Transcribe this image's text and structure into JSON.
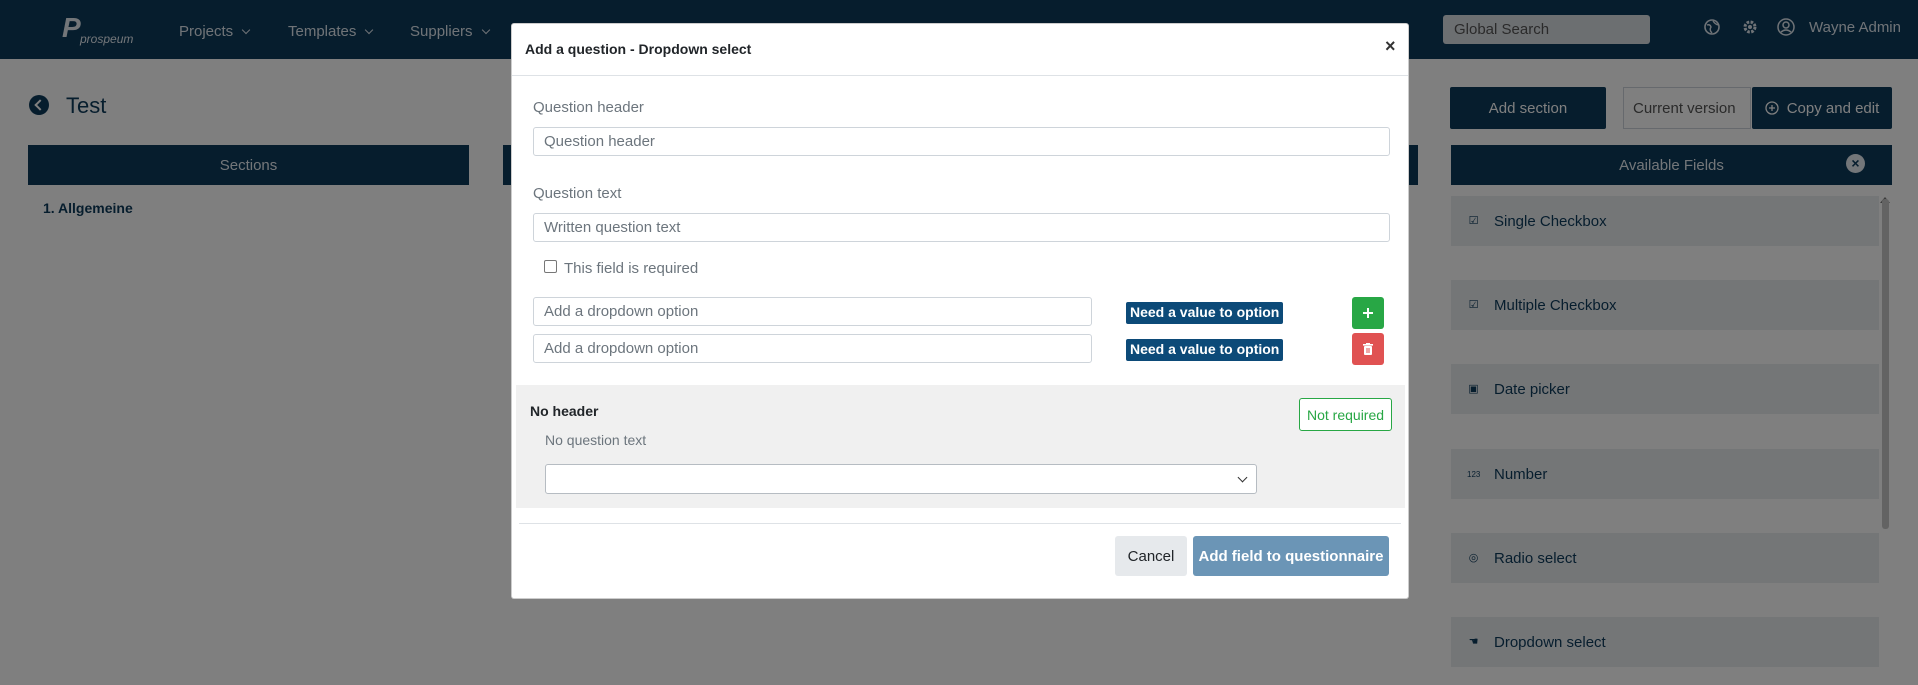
{
  "app": {
    "logo_mark": "P",
    "logo_word": "prospeum"
  },
  "nav": {
    "items": [
      {
        "label": "Projects"
      },
      {
        "label": "Templates"
      },
      {
        "label": "Suppliers"
      }
    ],
    "search_placeholder": "Global Search",
    "user_name": "Wayne Admin",
    "icons": [
      "globe-icon",
      "gear-icon",
      "user-circle-icon"
    ]
  },
  "page": {
    "title": "Test",
    "sections_header": "Sections",
    "sections": [
      "1. Allgemeine"
    ],
    "add_section_label": "Add section",
    "version_value": "Current version",
    "copy_edit_label": "Copy and edit",
    "available_fields_header": "Available Fields",
    "available_fields": [
      {
        "label": "Single Checkbox",
        "icon": "checkbox-icon"
      },
      {
        "label": "Multiple Checkbox",
        "icon": "multi-checkbox-icon"
      },
      {
        "label": "Date picker",
        "icon": "calendar-icon"
      },
      {
        "label": "Number",
        "icon": "number-icon",
        "glyph": "123"
      },
      {
        "label": "Radio select",
        "icon": "radio-check-icon"
      },
      {
        "label": "Dropdown select",
        "icon": "pointer-hand-icon"
      }
    ]
  },
  "modal": {
    "title": "Add a question - Dropdown select",
    "close_symbol": "×",
    "question_header_label": "Question header",
    "question_header_placeholder": "Question header",
    "question_text_label": "Question text",
    "question_text_placeholder": "Written question text",
    "required_label": "This field is required",
    "required_checked": false,
    "options": [
      {
        "placeholder": "Add a dropdown option",
        "badge": "Need a value to option",
        "action": "add"
      },
      {
        "placeholder": "Add a dropdown option",
        "badge": "Need a value to option",
        "action": "delete"
      }
    ],
    "preview": {
      "header": "No header",
      "text": "No question text",
      "required_badge": "Not required"
    },
    "cancel_label": "Cancel",
    "submit_label": "Add field to questionnaire"
  },
  "colors": {
    "navy": "#0c3a5b",
    "badge_blue": "#0c4a78",
    "success": "#28a745",
    "danger": "#e05252",
    "submit_disabled": "#6b95b6"
  }
}
